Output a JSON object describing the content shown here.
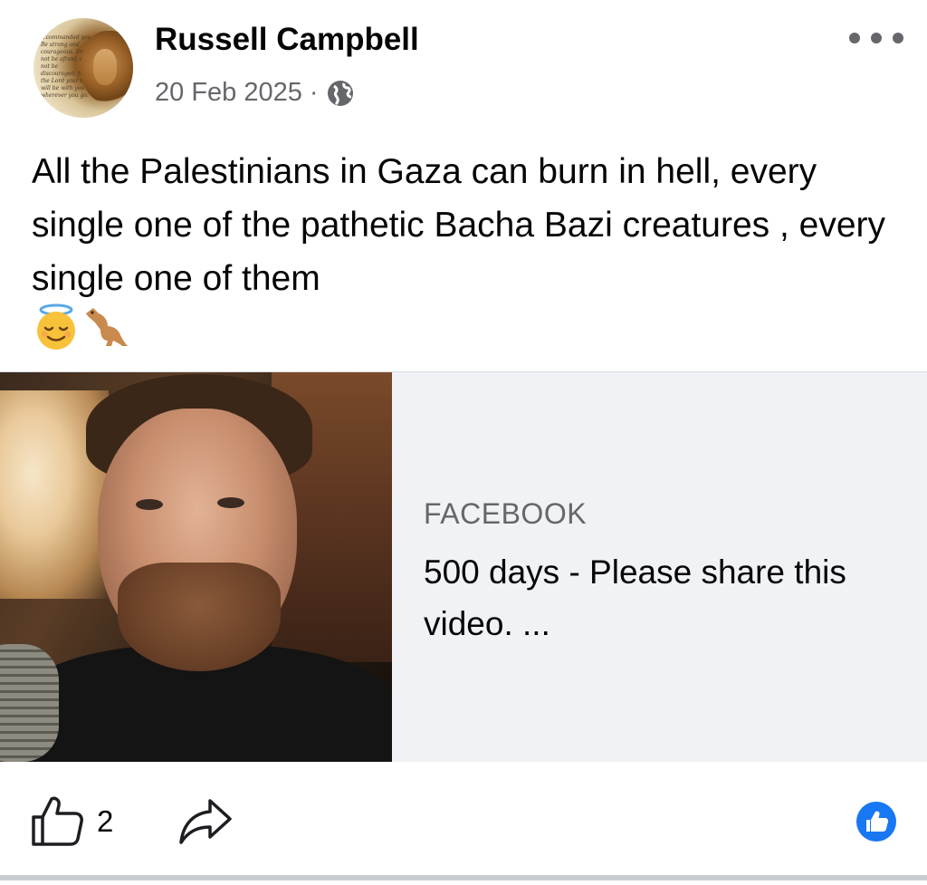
{
  "post": {
    "author": "Russell Campbell",
    "date": "20 Feb 2025",
    "separator": "·",
    "privacy_icon": "globe-icon",
    "more_icon": "more-options-icon",
    "text": "All the Palestinians in Gaza can burn in hell, every single one of the pathetic Bacha Bazi creatures , every single one of them",
    "emojis": [
      "smiling-face-with-halo",
      "kangaroo"
    ]
  },
  "avatar": {
    "scripture_text": "...commanded you. Be strong and courageous. Do not be afraid; do not be discouraged, for the Lord your God will be with you wherever you go."
  },
  "link_card": {
    "source": "FACEBOOK",
    "title": "500 days - Please share this video. ..."
  },
  "actions": {
    "like_count": "2",
    "like_icon": "thumbs-up-icon",
    "share_icon": "share-arrow-icon",
    "reaction_icon": "like-reaction-icon"
  },
  "colors": {
    "text_primary": "#050505",
    "text_secondary": "#65676b",
    "card_bg": "#f0f2f5",
    "reaction_blue": "#1877f2"
  }
}
